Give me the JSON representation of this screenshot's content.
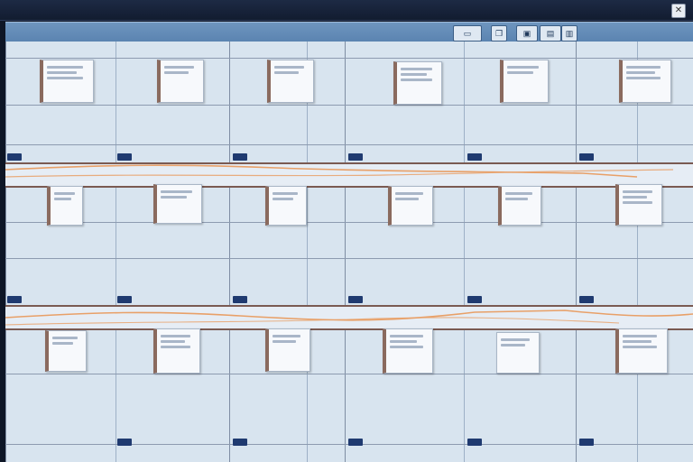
{
  "window": {
    "title": "",
    "close_icon": "close-icon"
  },
  "toolbar": {
    "buttons": [
      "select-icon",
      "copy-icon",
      "panel-icon"
    ]
  },
  "columns": [
    {
      "label": ""
    },
    {
      "label": ""
    },
    {
      "label": ""
    },
    {
      "label": ""
    },
    {
      "label": ""
    },
    {
      "label": ""
    }
  ],
  "rows": [
    {
      "label": ""
    },
    {
      "label": ""
    },
    {
      "label": ""
    }
  ],
  "cards": [
    {
      "title": ""
    },
    {
      "title": ""
    },
    {
      "title": ""
    },
    {
      "title": ""
    },
    {
      "title": ""
    },
    {
      "title": ""
    },
    {
      "title": ""
    },
    {
      "title": ""
    },
    {
      "title": ""
    },
    {
      "title": ""
    },
    {
      "title": ""
    },
    {
      "title": ""
    },
    {
      "title": ""
    },
    {
      "title": ""
    },
    {
      "title": ""
    },
    {
      "title": ""
    },
    {
      "title": ""
    },
    {
      "title": ""
    }
  ],
  "colors": {
    "toolbar": "#5a83b0",
    "grid": "#d8e4ef",
    "band_border": "#7a5a52",
    "marker": "#1f3a70",
    "connector": "#e8a068"
  }
}
